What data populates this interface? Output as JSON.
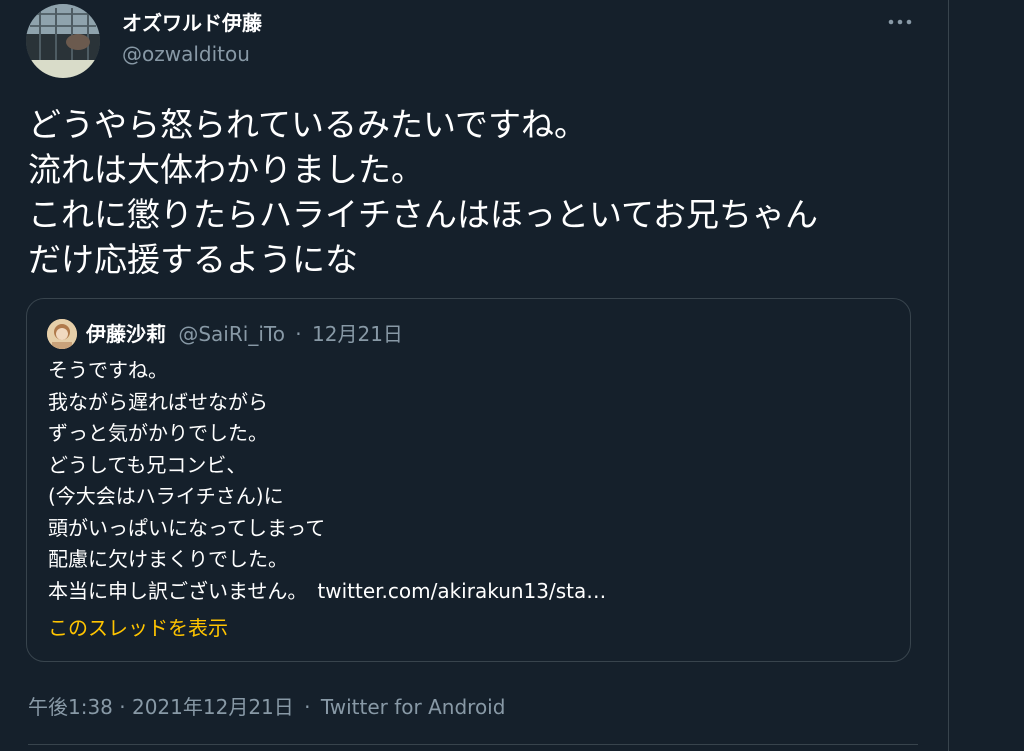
{
  "author": {
    "display_name": "オズワルド伊藤",
    "handle": "@ozwalditou"
  },
  "tweet": {
    "lines": [
      "どうやら怒られているみたいですね。",
      "流れは大体わかりました。",
      "これに懲りたらハライチさんはほっといてお兄ちゃん",
      "だけ応援するようにな"
    ],
    "timestamp": "午後1:38 · 2021年12月21日",
    "source": "Twitter for Android"
  },
  "quote": {
    "display_name": "伊藤沙莉",
    "handle": "@SaiRi_iTo",
    "separator": "·",
    "date": "12月21日",
    "lines": [
      "そうですね。",
      "我ながら遅ればせながら",
      "ずっと気がかりでした。",
      "どうしても兄コンビ、",
      "(今大会はハライチさん)に",
      "頭がいっぱいになってしまって",
      "配慮に欠けまくりでした。",
      "本当に申し訳ございません。"
    ],
    "link_text": "twitter.com/akirakun13/sta…",
    "show_thread_label": "このスレッドを表示"
  },
  "icons": {
    "more": "more-horizontal-icon"
  },
  "colors": {
    "background": "#15202b",
    "text_primary": "#ffffff",
    "text_secondary": "#8899a6",
    "border": "#38444d",
    "accent": "#ffc400"
  }
}
